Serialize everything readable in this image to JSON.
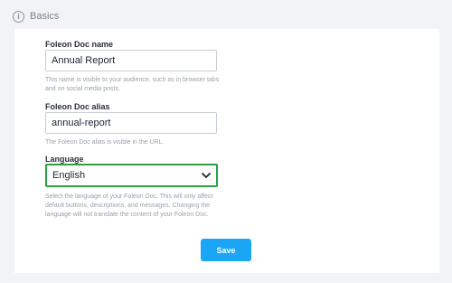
{
  "section": {
    "title": "Basics",
    "icon": "info-icon"
  },
  "fields": {
    "name": {
      "label": "Foleon Doc name",
      "value": "Annual Report",
      "help": "This name is visible to your audience, such as in browser tabs and on social media posts."
    },
    "alias": {
      "label": "Foleon Doc alias",
      "value": "annual-report",
      "help": "The Foleon Doc alias is visible in the URL."
    },
    "language": {
      "label": "Language",
      "value": "English",
      "help": "Select the language of your Foleon Doc. This will only affect default buttons, descriptions, and messages. Changing the language will not translate the content of your Foleon Doc."
    }
  },
  "actions": {
    "save_label": "Save"
  },
  "colors": {
    "accent": "#1aa6f4",
    "focus_border": "#2ea043",
    "background": "#f1f3f6"
  }
}
